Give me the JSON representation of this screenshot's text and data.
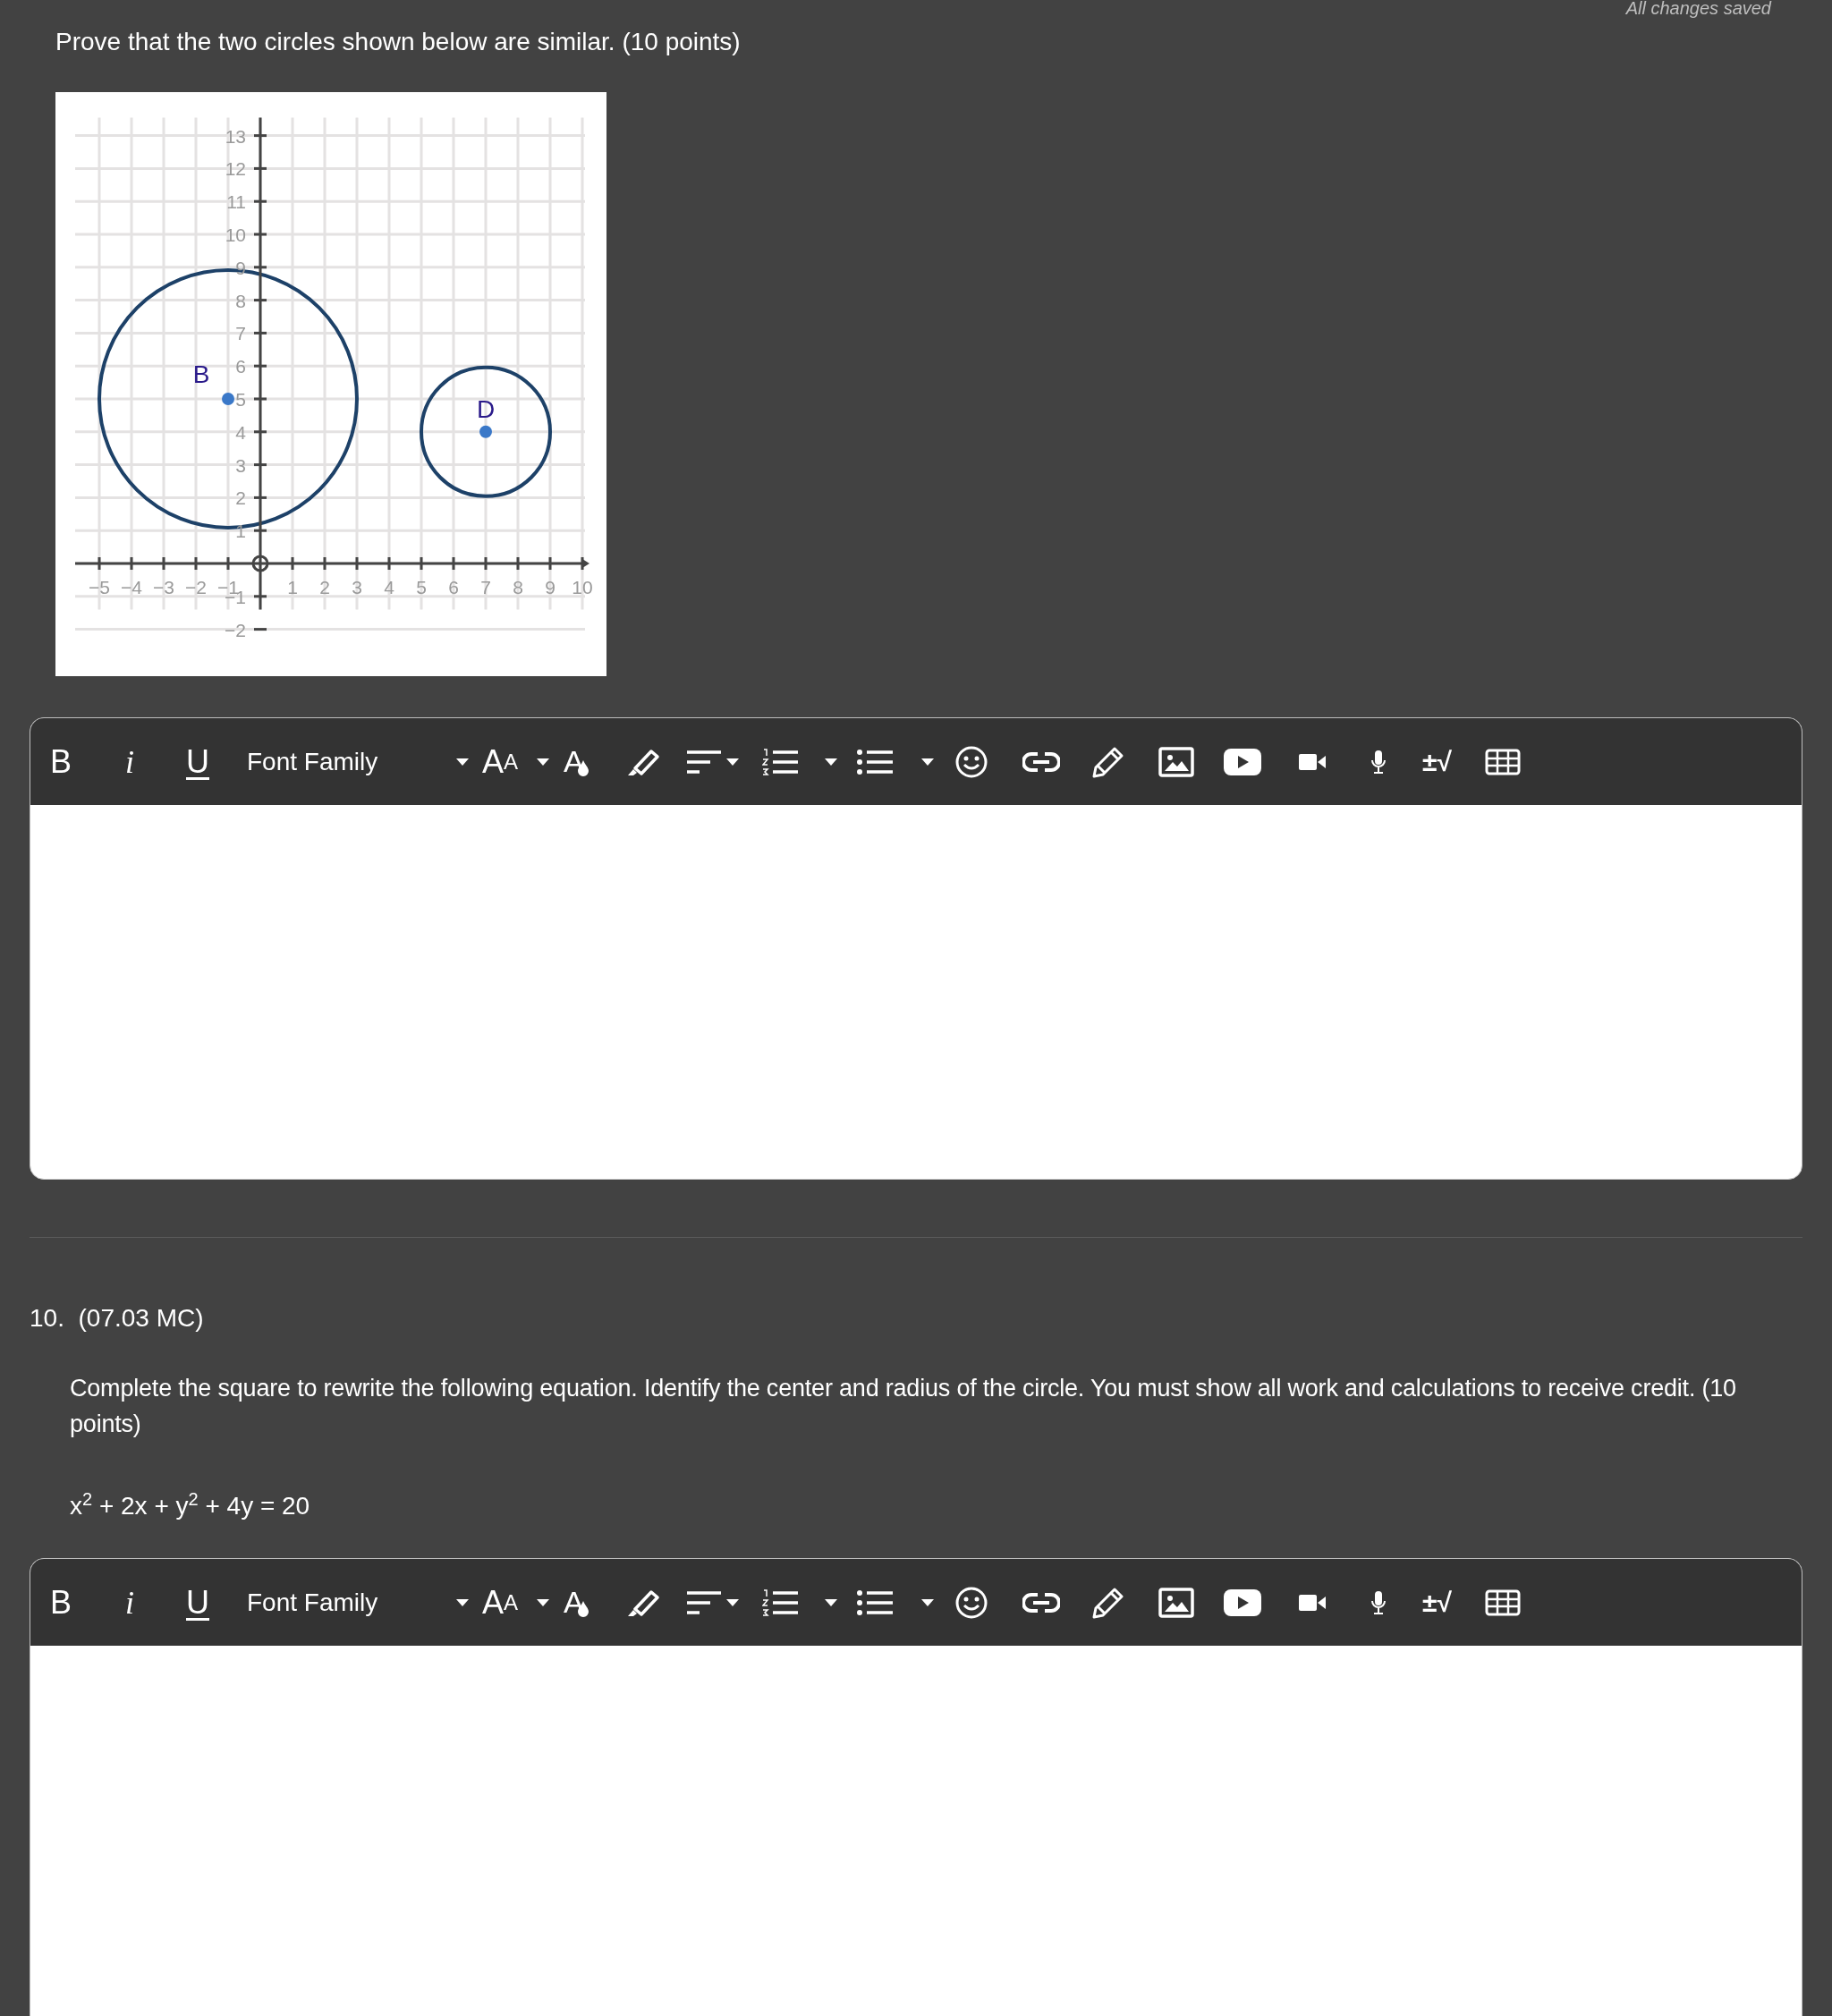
{
  "status": "All changes saved",
  "question_9": {
    "prompt": "Prove that the two circles shown below are similar. (10 points)",
    "graph": {
      "chart_data": {
        "type": "scatter",
        "xlim": [
          -5,
          10
        ],
        "ylim": [
          -2,
          13
        ],
        "xticks": [
          {
            "value": -5,
            "label": "−5"
          },
          {
            "value": -4,
            "label": "−4"
          },
          {
            "value": -3,
            "label": "−3"
          },
          {
            "value": -2,
            "label": "−2"
          },
          {
            "value": -1,
            "label": "−1"
          },
          1,
          2,
          3,
          4,
          5,
          6,
          7,
          8,
          9,
          10
        ],
        "yticks": [
          {
            "value": -2,
            "label": "−2"
          },
          {
            "value": -1,
            "label": "−1"
          },
          1,
          2,
          3,
          4,
          5,
          6,
          7,
          8,
          9,
          10,
          11,
          12,
          13
        ],
        "grid": true,
        "series": [
          {
            "name": "B",
            "color": "#3a78c8",
            "x": [
              -1
            ],
            "values": [
              5
            ]
          },
          {
            "name": "D",
            "color": "#3a78c8",
            "x": [
              7
            ],
            "values": [
              4
            ]
          }
        ]
      }
    },
    "editor": {
      "toolbar": {
        "bold": "B",
        "italic": "i",
        "underline": "U",
        "font_family": "Font Family",
        "font_size": "AA",
        "text_color": "A",
        "math": "±√"
      }
    }
  },
  "question_10": {
    "number": "10.",
    "code": "(07.03 MC)",
    "prompt": "Complete the square to rewrite the following equation. Identify the center and radius of the circle. You must show all work and calculations to receive credit. (10 points)",
    "equation": "x$^{2}$ + 2x + y$^{2}$ + 4y = 20",
    "editor": {
      "toolbar": {
        "bold": "B",
        "italic": "i",
        "underline": "U",
        "font_family": "Font Family",
        "font_size": "AA",
        "text_color": "A",
        "math": "±√"
      }
    }
  }
}
